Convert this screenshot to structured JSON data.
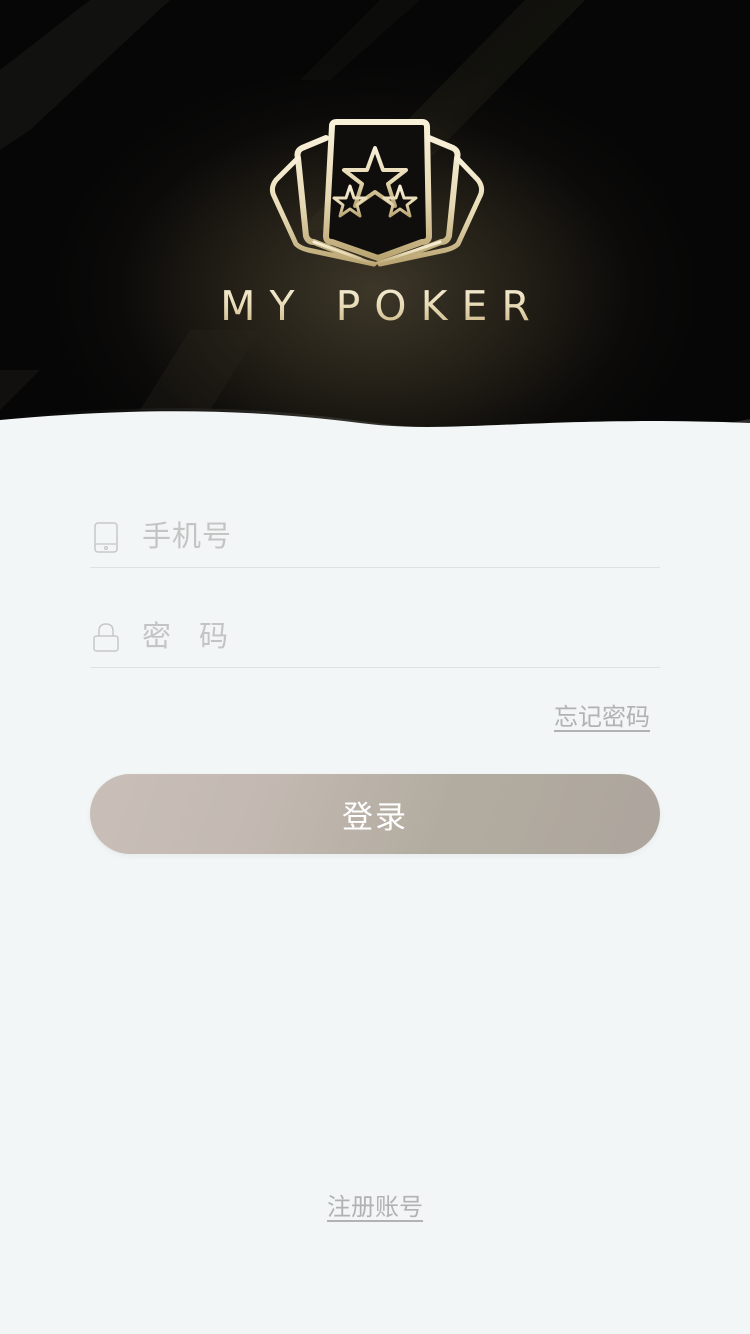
{
  "brand": {
    "name": "MY POKER",
    "logo_icon": "poker-cards-star-logo",
    "accent_gold": "#e8dbb7"
  },
  "form": {
    "phone": {
      "placeholder": "手机号",
      "icon": "phone-icon"
    },
    "password": {
      "placeholder": "密码",
      "icon": "lock-icon"
    },
    "forgot_label": "忘记密码",
    "login_label": "登录",
    "register_label": "注册账号"
  },
  "colors": {
    "background": "#f2f6f6",
    "header_dark": "#060606",
    "button": "#c3b9b2",
    "muted_text": "#b2b2b2"
  }
}
